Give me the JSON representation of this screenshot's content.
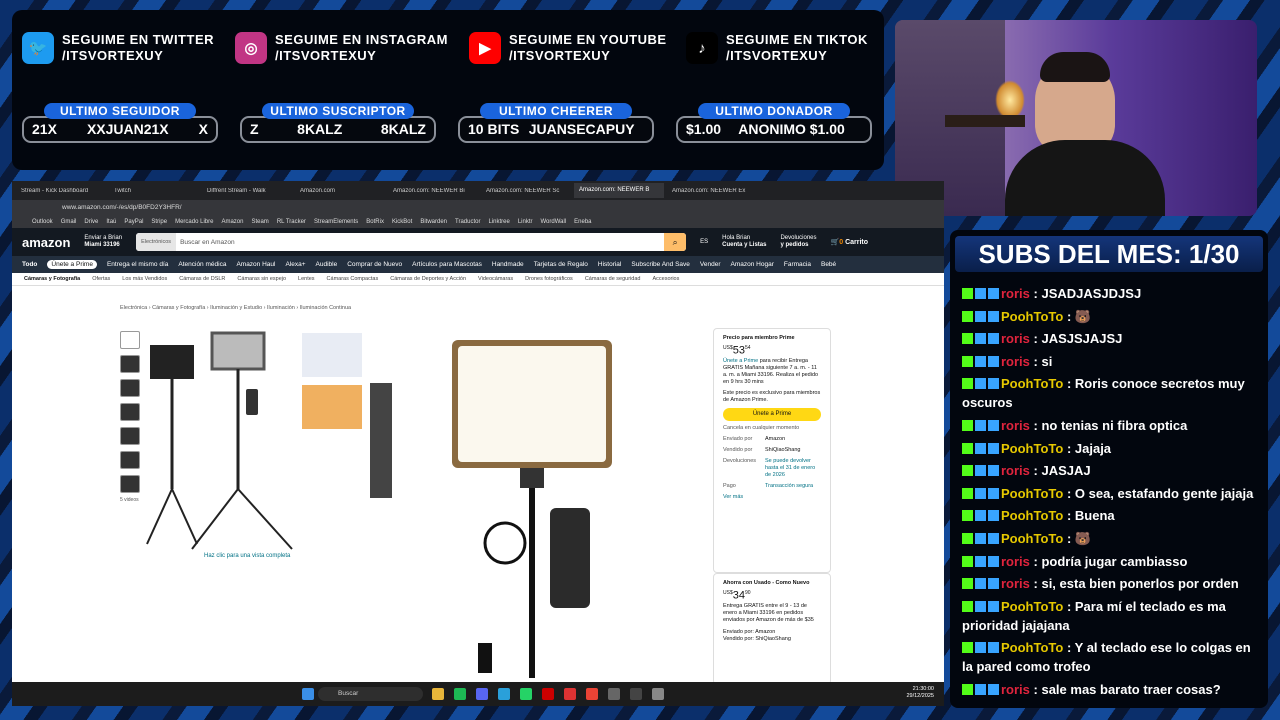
{
  "social": [
    {
      "icon": "twitter-icon",
      "line1": "SEGUIME EN TWITTER",
      "line2": "/ITSVORTEXUY",
      "color": "#1d9bf0",
      "glyph": "🐦"
    },
    {
      "icon": "instagram-icon",
      "line1": "SEGUIME EN INSTAGRAM",
      "line2": "/ITSVORTEXUY",
      "color": "#c13584",
      "glyph": "◎"
    },
    {
      "icon": "youtube-icon",
      "line1": "SEGUIME EN YOUTUBE",
      "line2": "/ITSVORTEXUY",
      "color": "#ff0000",
      "glyph": "▶"
    },
    {
      "icon": "tiktok-icon",
      "line1": "SEGUIME EN TIKTOK",
      "line2": "/ITSVORTEXUY",
      "color": "#000000",
      "glyph": "♪"
    }
  ],
  "stats": [
    {
      "label": "ULTIMO SEGUIDOR",
      "left": "21X",
      "center": "XXJUAN21X",
      "right": "X"
    },
    {
      "label": "ULTIMO SUSCRIPTOR",
      "left": "Z",
      "center": "8KALZ",
      "right": "8KALZ"
    },
    {
      "label": "ULTIMO CHEERER",
      "left": "10 BITS",
      "center": "JUANSECAPUY",
      "right": ""
    },
    {
      "label": "ULTIMO DONADOR",
      "left": "$1.00",
      "center": "ANONIMO $1.00",
      "right": ""
    }
  ],
  "subs_title": "SUBS DEL MES: 1/30",
  "chat": [
    {
      "user": "roris",
      "color": "r",
      "text": "JSADJASJDJSJ"
    },
    {
      "user": "PoohToTo",
      "color": "p",
      "text": "🐻"
    },
    {
      "user": "roris",
      "color": "r",
      "text": "JASJSJAJSJ"
    },
    {
      "user": "roris",
      "color": "r",
      "text": "si"
    },
    {
      "user": "PoohToTo",
      "color": "p",
      "text": "Roris conoce secretos muy oscuros"
    },
    {
      "user": "roris",
      "color": "r",
      "text": "no tenias ni fibra optica"
    },
    {
      "user": "PoohToTo",
      "color": "p",
      "text": "Jajaja"
    },
    {
      "user": "roris",
      "color": "r",
      "text": "JASJAJ"
    },
    {
      "user": "PoohToTo",
      "color": "p",
      "text": "O sea, estafando gente jajaja"
    },
    {
      "user": "PoohToTo",
      "color": "p",
      "text": "Buena"
    },
    {
      "user": "PoohToTo",
      "color": "p",
      "text": "🐻"
    },
    {
      "user": "roris",
      "color": "r",
      "text": "podría jugar cambiasso"
    },
    {
      "user": "roris",
      "color": "r",
      "text": "si, esta bien ponerlos por orden"
    },
    {
      "user": "PoohToTo",
      "color": "p",
      "text": "Para mí el teclado es ma prioridad jajajana"
    },
    {
      "user": "PoohToTo",
      "color": "p",
      "text": "Y al teclado ese lo colgas en la pared como trofeo"
    },
    {
      "user": "roris",
      "color": "r",
      "text": "sale mas barato traer cosas?"
    }
  ],
  "browser": {
    "tabs": [
      "Stream - Kick Dashboard",
      "Twitch",
      "Diffrent Stream - Walk",
      "Amazon.com",
      "Amazon.com: NEEWER Bi",
      "Amazon.com: NEEWER Sc",
      "Amazon.com: NEEWER B",
      "Amazon.com: NEEWER Ex"
    ],
    "url": "www.amazon.com/-/es/dp/B0FD2Y3HFR/",
    "bookmarks": [
      "Outlook",
      "Gmail",
      "Drive",
      "Itaú",
      "PayPal",
      "Stripe",
      "Mercado Libre",
      "Amazon",
      "Steam",
      "RL Tracker",
      "StreamElements",
      "BotRix",
      "KickBot",
      "Bitwarden",
      "Traductor",
      "Linktree",
      "Linktr",
      "WordWall",
      "Eneba"
    ]
  },
  "amazon": {
    "logo": "amazon",
    "deliver_line1": "Enviar a Brian",
    "deliver_line2": "Miami 33196",
    "search_category": "Electrónicos",
    "search_placeholder": "Buscar en Amazon",
    "lang": "ES",
    "account_line1": "Hola Brian",
    "account_line2": "Cuenta y Listas",
    "orders_line1": "Devoluciones",
    "orders_line2": "y pedidos",
    "cart": "Carrito",
    "cart_count": "0",
    "nav": [
      "Todo",
      "Únete a Prime",
      "Entrega el mismo día",
      "Atención médica",
      "Amazon Haul",
      "Alexa+",
      "Audible",
      "Comprar de Nuevo",
      "Artículos para Mascotas",
      "Handmade",
      "Tarjetas de Regalo",
      "Historial",
      "Subscribe And Save",
      "Vender",
      "Amazon Hogar",
      "Farmacia",
      "Bebé"
    ],
    "subnav": [
      "Cámaras y Fotografía",
      "Ofertas",
      "Los más Vendidos",
      "Cámaras de DSLR",
      "Cámaras sin espejo",
      "Lentes",
      "Cámaras Compactas",
      "Cámaras de Deportes y Acción",
      "Videocámaras",
      "Drones fotográficos",
      "Cámaras de seguridad",
      "Accesorios"
    ],
    "breadcrumb": "Electrónica › Cámaras y Fotografía › Iluminación y Estudio › Iluminación › Iluminación Continua",
    "zoom_link": "Haz clic para una vista completa",
    "videos": "5 videos",
    "buybox": {
      "prime_label": "Precio para miembro Prime",
      "price_currency": "US$",
      "price_whole": "53",
      "price_frac": "54",
      "join_link": "Únete a Prime",
      "join_text": "para recibir Entrega GRATIS Mañana siguiente 7 a. m. - 11 a. m. a Miami 33196. Realiza el pedido en 9 hrs 30 mins",
      "exclusive": "Este precio es exclusivo para miembros de Amazon Prime.",
      "btn": "Únete a Prime",
      "cancel": "Cancela en cualquier momento",
      "rows": [
        [
          "Enviado por",
          "Amazon"
        ],
        [
          "Vendido por",
          "ShiQiaoShang"
        ],
        [
          "Devoluciones",
          "Se puede devolver hasta el 31 de enero de 2026"
        ],
        [
          "Pago",
          "Transacción segura"
        ]
      ],
      "more": "Ver más"
    },
    "buybox2": {
      "title": "Ahorra con Usado - Como Nuevo",
      "price_currency": "US$",
      "price_whole": "34",
      "price_frac": "90",
      "delivery": "Entrega GRATIS entre el 9 - 13 de enero a Miami 33196 en pedidos enviados por Amazon de más de $35",
      "sent": "Enviado por: Amazon",
      "sold": "Vendido por: ShiQiaoShang"
    }
  },
  "taskbar": {
    "search": "Buscar",
    "time": "21:30:00",
    "date": "29/12/2025"
  }
}
